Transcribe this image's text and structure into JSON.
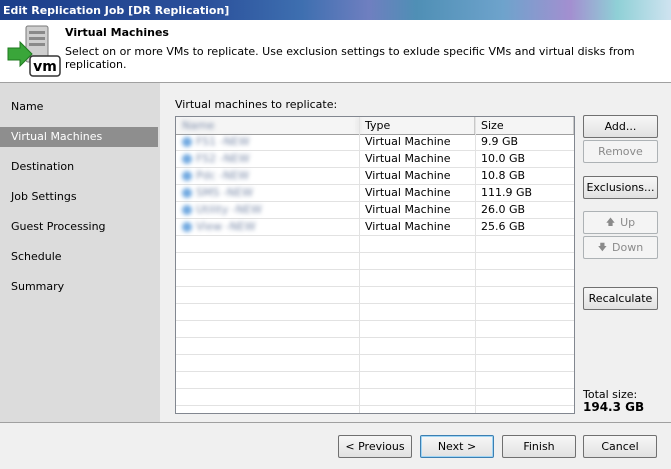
{
  "window": {
    "title": "Edit Replication Job [DR Replication]"
  },
  "header": {
    "title": "Virtual Machines",
    "description": "Select on or more VMs to replicate. Use exclusion settings to exlude specific VMs and virtual disks from replication.",
    "icon": "vm-server-icon"
  },
  "nav": {
    "items": [
      {
        "label": "Name",
        "active": false
      },
      {
        "label": "Virtual Machines",
        "active": true
      },
      {
        "label": "Destination",
        "active": false
      },
      {
        "label": "Job Settings",
        "active": false
      },
      {
        "label": "Guest Processing",
        "active": false
      },
      {
        "label": "Schedule",
        "active": false
      },
      {
        "label": "Summary",
        "active": false
      }
    ]
  },
  "content": {
    "list_label": "Virtual machines to replicate:",
    "columns": [
      "Name",
      "Type",
      "Size"
    ],
    "rows": [
      {
        "name": "FS1 -NEW",
        "type": "Virtual Machine",
        "size": "9.9 GB"
      },
      {
        "name": "FS2 -NEW",
        "type": "Virtual Machine",
        "size": "10.0 GB"
      },
      {
        "name": "Pdc -NEW",
        "type": "Virtual Machine",
        "size": "10.8 GB"
      },
      {
        "name": "SMS -NEW",
        "type": "Virtual Machine",
        "size": "111.9 GB"
      },
      {
        "name": "Utility -NEW",
        "type": "Virtual Machine",
        "size": "26.0 GB"
      },
      {
        "name": "View -NEW",
        "type": "Virtual Machine",
        "size": "25.6 GB"
      }
    ],
    "buttons": {
      "add": "Add...",
      "remove": "Remove",
      "exclusions": "Exclusions...",
      "up": "Up",
      "down": "Down",
      "recalculate": "Recalculate"
    },
    "total_label": "Total size:",
    "total_value": "194.3 GB"
  },
  "footer": {
    "previous": "< Previous",
    "next": "Next >",
    "finish": "Finish",
    "cancel": "Cancel"
  }
}
